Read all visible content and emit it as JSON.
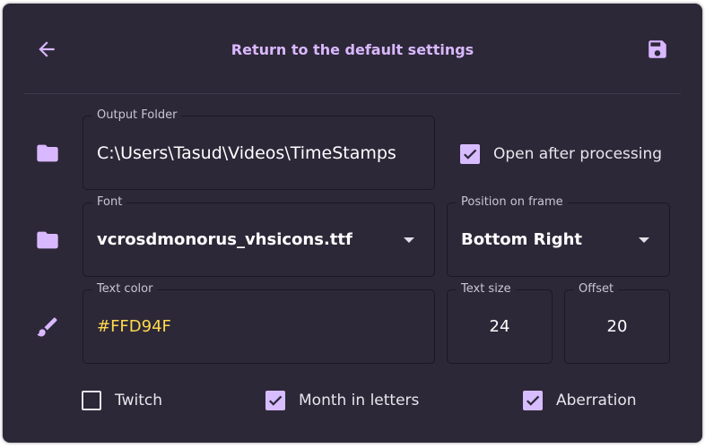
{
  "header": {
    "title": "Return to the default settings",
    "back_icon": "arrow-left-icon",
    "save_icon": "save-icon"
  },
  "output_folder": {
    "label": "Output Folder",
    "value": "C:\\Users\\Tasud\\Videos\\TimeStamps",
    "icon": "folder-icon"
  },
  "open_after_processing": {
    "label": "Open after processing",
    "checked": true
  },
  "font": {
    "label": "Font",
    "value": "vcrosdmonorus_vhsicons.ttf",
    "icon": "folder-icon"
  },
  "position": {
    "label": "Position on frame",
    "value": "Bottom Right"
  },
  "text_color": {
    "label": "Text color",
    "value": "#FFD94F",
    "icon": "brush-icon"
  },
  "text_size": {
    "label": "Text size",
    "value": "24"
  },
  "offset": {
    "label": "Offset",
    "value": "20"
  },
  "options": {
    "twitch": {
      "label": "Twitch",
      "checked": false
    },
    "month_in_letters": {
      "label": "Month in letters",
      "checked": true
    },
    "aberration": {
      "label": "Aberration",
      "checked": true
    }
  },
  "colors": {
    "accent": "#D7BCFF",
    "background": "#2D2838",
    "text_color_value": "#FFD94F"
  }
}
